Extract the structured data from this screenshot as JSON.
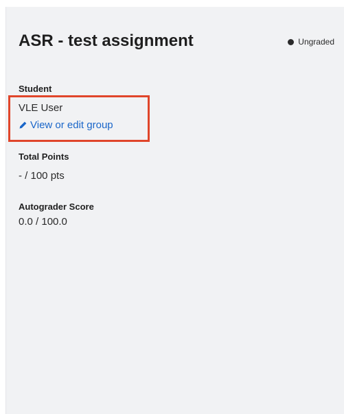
{
  "assignment": {
    "title": "ASR - test assignment",
    "status": "Ungraded"
  },
  "student": {
    "label": "Student",
    "name": "VLE User",
    "edit_link": "View or edit group"
  },
  "total_points": {
    "label": "Total Points",
    "value": "- / 100 pts"
  },
  "autograder": {
    "label": "Autograder Score",
    "value": "0.0 / 100.0"
  },
  "colors": {
    "panel_bg": "#f1f2f4",
    "link": "#1a66c9",
    "highlight_border": "#e0452a"
  },
  "icons": {
    "status": "filled-circle-icon",
    "edit": "pencil-icon"
  }
}
